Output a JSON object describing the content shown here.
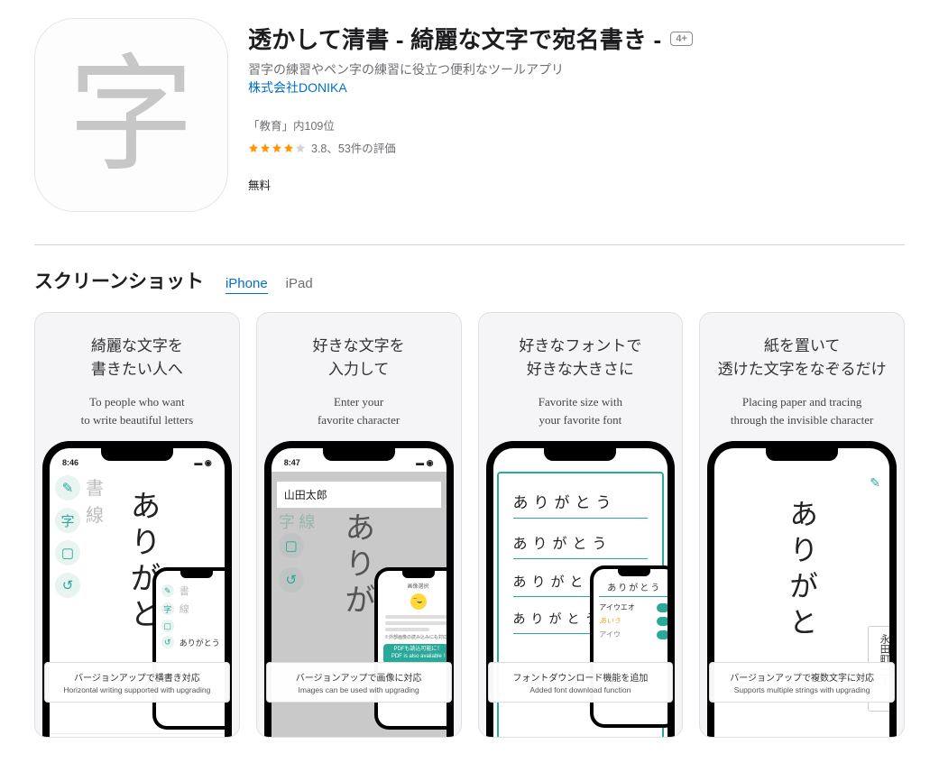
{
  "app": {
    "title": "透かして清書 - 綺麗な文字で宛名書き -",
    "age_badge": "4+",
    "subtitle": "習字の練習やペン字の練習に役立つ便利なツールアプリ",
    "developer": "株式会社DONIKA",
    "rank": "「教育」内109位",
    "rating": "3.8、53件の評価",
    "price": "無料",
    "icon_char": "字"
  },
  "section": {
    "heading": "スクリーンショット",
    "tabs": [
      "iPhone",
      "iPad"
    ]
  },
  "shots": [
    {
      "jp": "綺麗な文字を\n書きたい人へ",
      "en": "To people who want\nto write beautiful letters",
      "banner_jp": "バージョンアップで横書き対応",
      "banner_en": "Horizontal writing supported with upgrading",
      "sample_vert": "ありがと",
      "side_label": "書\n線",
      "mini_label": "ありがとう",
      "time": "8:46"
    },
    {
      "jp": "好きな文字を\n入力して",
      "en": "Enter your\nfavorite character",
      "banner_jp": "バージョンアップで画像に対応",
      "banner_en": "Images can be used with upgrading",
      "input_value": "山田太郎",
      "side_label": "字 線",
      "sample_vert": "ありが",
      "mini_pill": "PDFも読込可能に！\nPDF is also available !",
      "time": "8:47"
    },
    {
      "jp": "好きなフォントで\n好きな大きさに",
      "en": "Favorite size with\nyour favorite font",
      "banner_jp": "フォントダウンロード機能を追加",
      "banner_en": "Added font download function",
      "stacked": [
        "ありがとう",
        "ありがとう",
        "ありがとう",
        "ありがとう"
      ],
      "mini_label": "ありがとう",
      "mini_row1": "アイウエオ",
      "mini_row2": "あいう"
    },
    {
      "jp": "紙を置いて\n透けた文字をなぞるだけ",
      "en": "Placing paper and tracing\nthrough the invisible character",
      "banner_jp": "バージョンアップで複数文字に対応",
      "banner_en": "Supports multiple strings with upgrading",
      "sample_vert": "ありがと",
      "addr": "東京都千代田区\n永田町一丁"
    }
  ]
}
